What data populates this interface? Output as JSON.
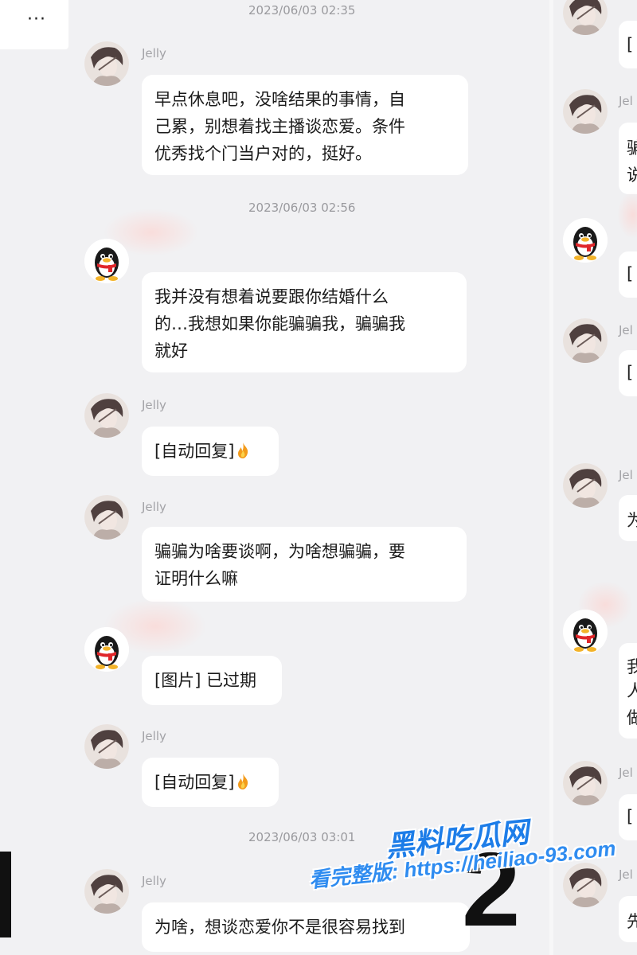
{
  "menu": {
    "label": "···"
  },
  "timestamps": [
    "2023/06/03 02:35",
    "2023/06/03 02:56",
    "2023/06/03 03:01"
  ],
  "messages": [
    {
      "sender": "Jelly",
      "lines": [
        "早点休息吧，没啥结果的事情，自",
        "己累，别想着找主播谈恋爱。条件",
        "优秀找个门当户对的，挺好。"
      ]
    },
    {
      "sender": "",
      "lines": [
        "我并没有想着说要跟你结婚什么",
        "的…我想如果你能骗骗我，骗骗我",
        "就好"
      ]
    },
    {
      "sender": "Jelly",
      "lines": [
        "[自动回复]"
      ]
    },
    {
      "sender": "Jelly",
      "lines": [
        "骗骗为啥要谈啊，为啥想骗骗，要",
        "证明什么嘛"
      ]
    },
    {
      "sender": "",
      "lines": [
        "[图片] 已过期"
      ]
    },
    {
      "sender": "Jelly",
      "lines": [
        "[自动回复]"
      ]
    },
    {
      "sender": "Jelly",
      "lines": [
        "为啥，想谈恋爱你不是很容易找到"
      ]
    }
  ],
  "right_pane": {
    "senders": [
      "Jel",
      "Jel",
      "Jel",
      "Jel",
      "Jel"
    ],
    "fragments": [
      "[",
      "骗",
      "说",
      "[",
      "[",
      "为",
      "我",
      "人",
      "做",
      "[",
      "先"
    ]
  },
  "overlay": {
    "big_number": "2"
  },
  "watermark": {
    "title": "黑料吃瓜网",
    "url": "看完整版: https://heiliao-93.com"
  },
  "icons": {
    "fire": "fire-emoji",
    "qq_avatar": "qq-penguin-icon",
    "jelly_avatar": "jelly-avatar"
  }
}
